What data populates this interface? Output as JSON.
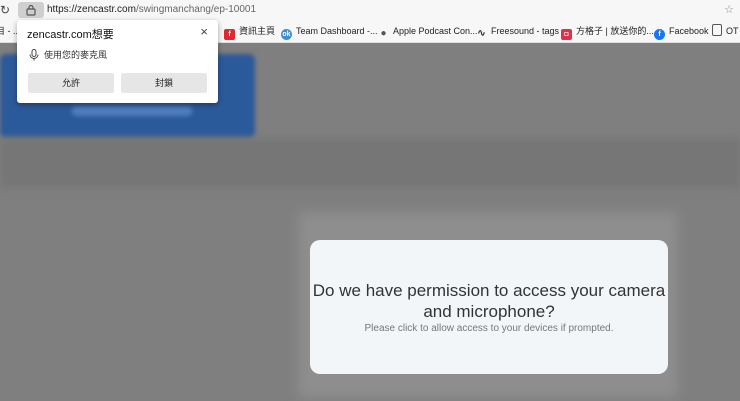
{
  "browser": {
    "url_main": "https://zencastr.com",
    "url_path": "/swingmanchang/ep-10001"
  },
  "bookmarks": [
    {
      "label": "目 - ...",
      "icon": "folder-icon",
      "color": "#666666"
    },
    {
      "label": "資訊主頁",
      "icon": "flipboard-icon",
      "color": "#e0282e"
    },
    {
      "label": "Team Dashboard -...",
      "icon": "ok-icon",
      "color": "#3b8fd6"
    },
    {
      "label": "Apple Podcast Con...",
      "icon": "apple-icon",
      "color": "#555555"
    },
    {
      "label": "Freesound - tags",
      "icon": "waveform-icon",
      "color": "#333333"
    },
    {
      "label": "方格子 | 放送你的...",
      "icon": "vocus-icon",
      "color": "#e02f4a"
    },
    {
      "label": "Facebook",
      "icon": "facebook-icon",
      "color": "#1877f2"
    },
    {
      "label": "OT",
      "icon": "document-icon",
      "color": "#555555"
    }
  ],
  "permission_popup": {
    "title": "zencastr.com想要",
    "description": "使用您的麥克風",
    "allow_label": "允許",
    "block_label": "封鎖",
    "close_icon": "×"
  },
  "modal": {
    "title": "Do we have permission to access your camera and microphone?",
    "subtitle": "Please click to allow access to your devices if prompted."
  }
}
